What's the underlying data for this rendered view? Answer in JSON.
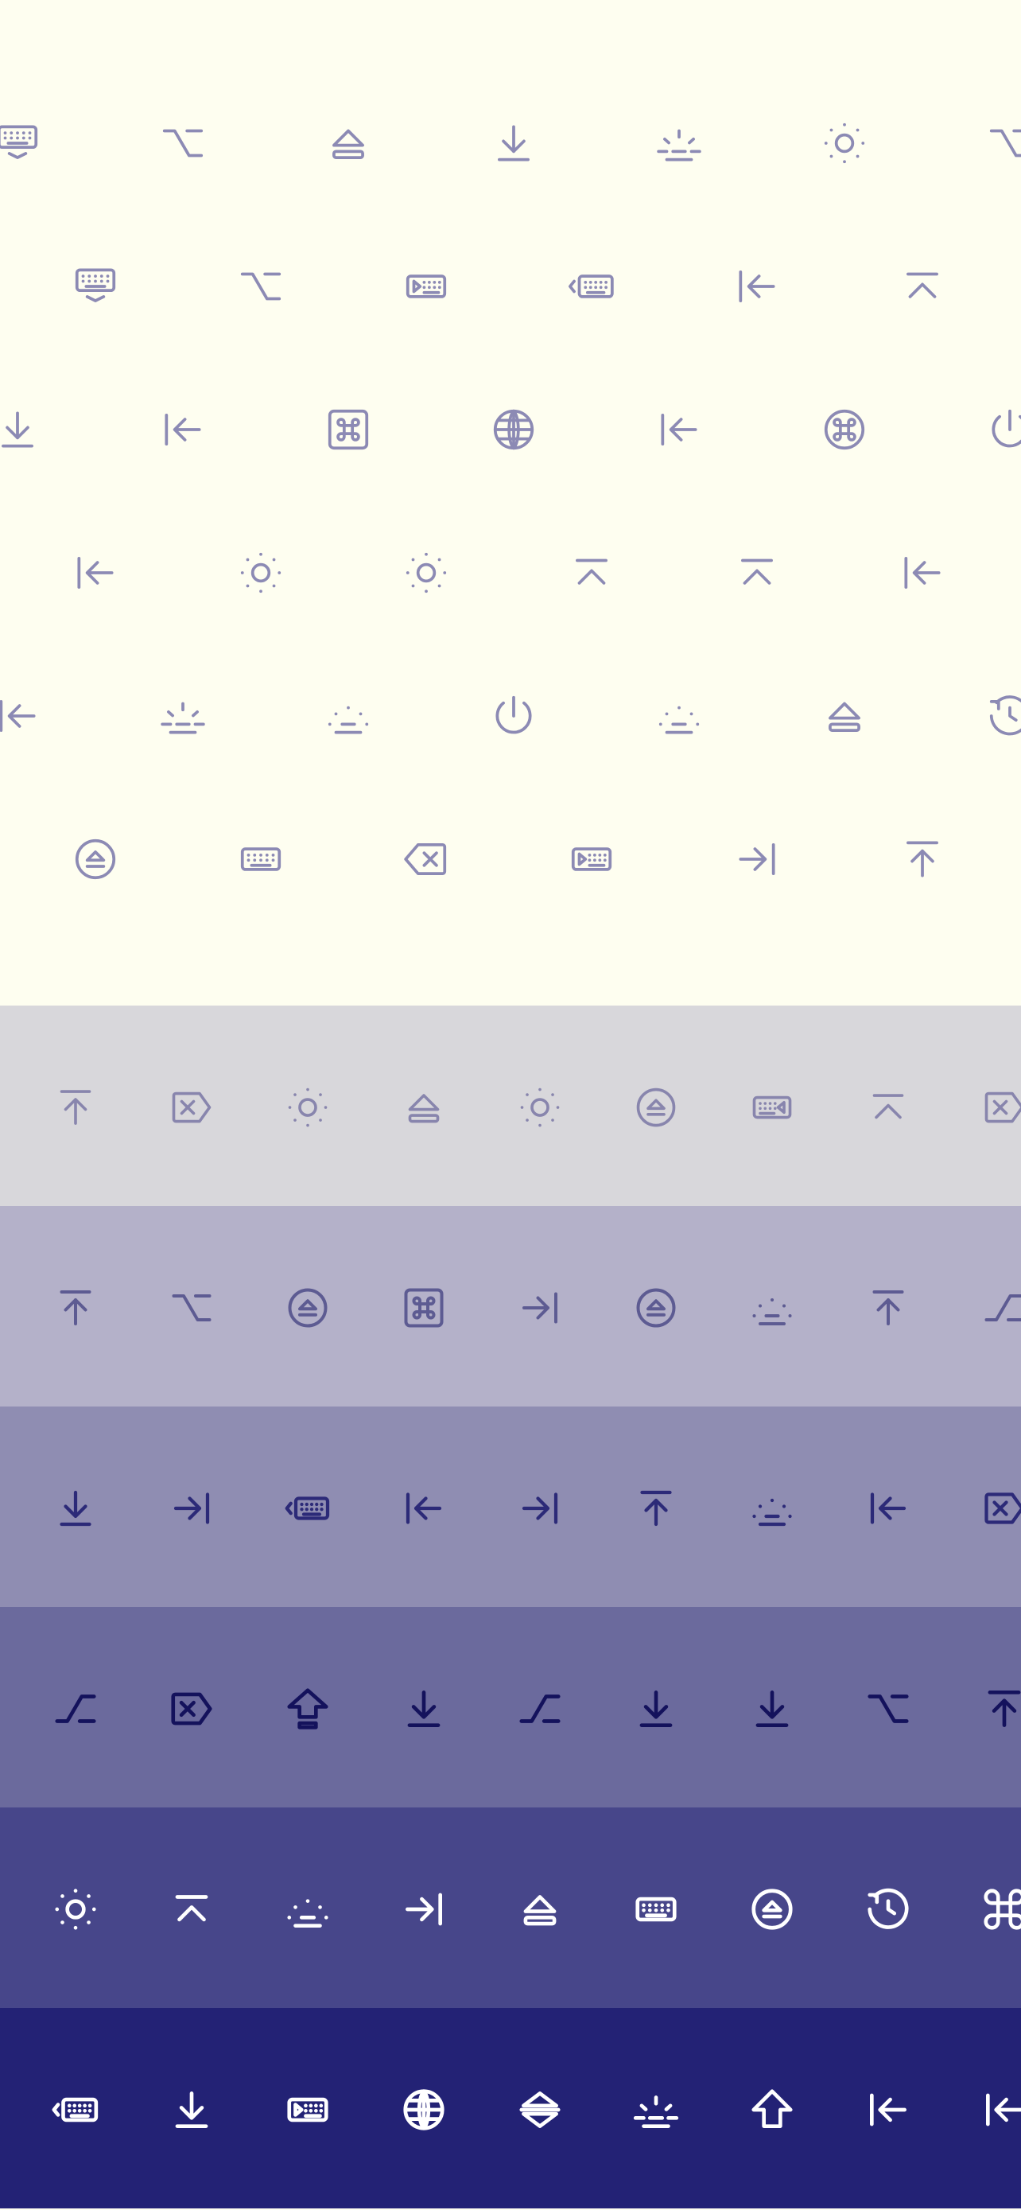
{
  "showcase": {
    "background": "#fefef0",
    "icon_color": "#8c8ab4",
    "rows": [
      [
        "keyboard-hide",
        "option",
        "eject",
        "download",
        "sunrise",
        "brightness",
        "option"
      ],
      [
        "keyboard-hide",
        "option",
        "keyboard-play",
        "keyboard-back",
        "arrow-to-left",
        "chevron-to-top"
      ],
      [
        "download",
        "arrow-to-left",
        "command-square",
        "globe",
        "arrow-to-left",
        "command-circle",
        "power"
      ],
      [
        "arrow-to-left",
        "brightness",
        "brightness",
        "chevron-to-top",
        "chevron-to-top",
        "arrow-to-left"
      ],
      [
        "arrow-to-left",
        "sunrise",
        "dim",
        "power",
        "dim",
        "eject",
        "restart"
      ],
      [
        "eject-circle",
        "keyboard",
        "delete",
        "keyboard-play",
        "arrow-to-right",
        "arrow-to-top"
      ]
    ]
  },
  "bands": [
    {
      "background": "#d8d7db",
      "icon_color": "#8885ad",
      "icons": [
        "arrow-to-top",
        "clear",
        "brightness",
        "eject",
        "brightness",
        "eject-circle",
        "keyboard-back-right",
        "chevron-to-top",
        "clear"
      ]
    },
    {
      "background": "#b4b1c9",
      "icon_color": "#5d5b92",
      "icons": [
        "arrow-to-top",
        "option",
        "eject-circle",
        "command-square",
        "arrow-to-right",
        "eject-circle",
        "dim",
        "arrow-to-top",
        "control"
      ]
    },
    {
      "background": "#8f8db2",
      "icon_color": "#2c2a78",
      "icons": [
        "download",
        "arrow-to-right",
        "keyboard-back",
        "arrow-to-left",
        "arrow-to-right",
        "arrow-to-top",
        "dim",
        "arrow-to-left",
        "clear"
      ]
    },
    {
      "background": "#6b6a9d",
      "icon_color": "#14125c",
      "icons": [
        "control",
        "clear",
        "shift-lock",
        "download",
        "control",
        "download",
        "download",
        "option",
        "arrow-to-top"
      ]
    },
    {
      "background": "#47468a",
      "icon_color": "#ffffff",
      "icons": [
        "brightness",
        "chevron-to-top",
        "dim",
        "arrow-to-right",
        "eject",
        "keyboard",
        "eject-circle",
        "restart",
        "command"
      ]
    },
    {
      "background": "#232275",
      "icon_color": "#ffffff",
      "icons": [
        "keyboard-back",
        "download",
        "keyboard-play",
        "globe",
        "expand",
        "sunrise",
        "shift",
        "arrow-to-left",
        "arrow-to-left"
      ]
    }
  ]
}
